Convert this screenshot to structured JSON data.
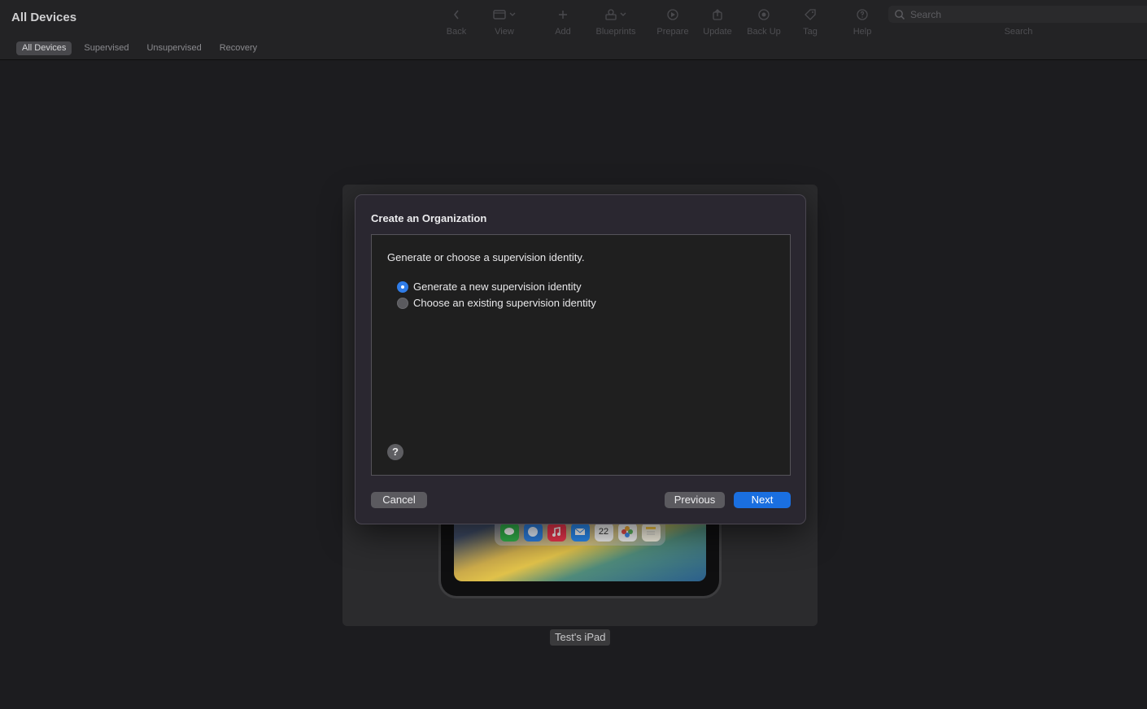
{
  "header": {
    "title": "All Devices",
    "filters": [
      "All Devices",
      "Supervised",
      "Unsupervised",
      "Recovery"
    ],
    "active_filter": "All Devices",
    "tools": [
      {
        "label": "Back",
        "icon": "chevron-left-icon"
      },
      {
        "label": "View",
        "icon": "view-icon"
      },
      {
        "label": "Add",
        "icon": "plus-icon"
      },
      {
        "label": "Blueprints",
        "icon": "blueprints-icon"
      },
      {
        "label": "Prepare",
        "icon": "prepare-icon"
      },
      {
        "label": "Update",
        "icon": "update-icon"
      },
      {
        "label": "Back Up",
        "icon": "backup-icon"
      },
      {
        "label": "Tag",
        "icon": "tag-icon"
      },
      {
        "label": "Help",
        "icon": "help-icon"
      }
    ],
    "search": {
      "placeholder": "Search",
      "label": "Search"
    }
  },
  "device": {
    "name": "Test's iPad",
    "dock_apps": [
      "messages-icon",
      "safari-icon",
      "music-icon",
      "mail-icon",
      "calendar-icon",
      "photos-icon",
      "notes-icon"
    ],
    "calendar_day": "22"
  },
  "dialog": {
    "title": "Create an Organization",
    "prompt": "Generate or choose a supervision identity.",
    "options": [
      {
        "label": "Generate a new supervision identity",
        "selected": true
      },
      {
        "label": "Choose an existing supervision identity",
        "selected": false
      }
    ],
    "help_label": "?",
    "cancel_label": "Cancel",
    "previous_label": "Previous",
    "next_label": "Next"
  },
  "colors": {
    "accent": "#1a6fe0",
    "background": "#1c1c1f",
    "dialog": "#2a2730"
  }
}
